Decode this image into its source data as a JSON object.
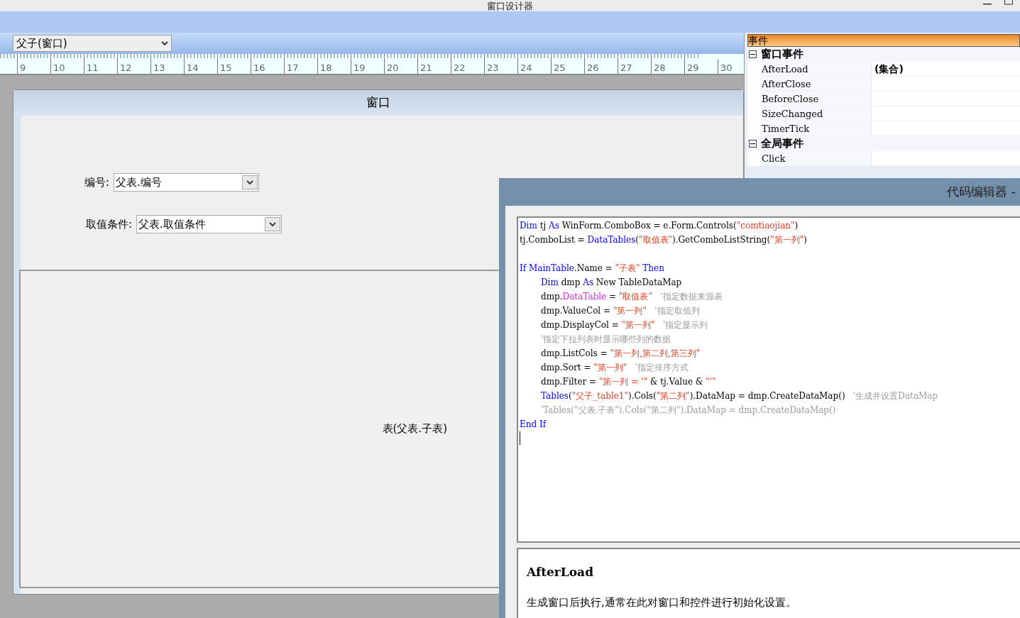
{
  "window": {
    "title": "窗口设计器"
  },
  "toolbar": {
    "form_select": "父子(窗口)"
  },
  "ruler": [
    "9",
    "10",
    "11",
    "12",
    "13",
    "14",
    "15",
    "16",
    "17",
    "18",
    "19",
    "20",
    "21",
    "22",
    "23",
    "24",
    "25",
    "26",
    "27",
    "28",
    "29",
    "30"
  ],
  "form": {
    "title": "窗口",
    "fields": [
      {
        "label": "编号:",
        "value": "父表.编号"
      },
      {
        "label": "取值条件:",
        "value": "父表.取值条件"
      }
    ],
    "table_label": "表(父表.子表)"
  },
  "events_panel": {
    "title": "事件",
    "groups": [
      {
        "name": "窗口事件",
        "expanded": true,
        "items": [
          {
            "name": "AfterLoad",
            "value": "(集合)"
          },
          {
            "name": "AfterClose"
          },
          {
            "name": "BeforeClose"
          },
          {
            "name": "SizeChanged"
          },
          {
            "name": "TimerTick"
          }
        ]
      },
      {
        "name": "全局事件",
        "expanded": true,
        "items": [
          {
            "name": "Click"
          }
        ]
      }
    ]
  },
  "code_editor": {
    "title": "代码编辑器 -",
    "lines": [
      {
        "tokens": [
          {
            "kind": "kw",
            "text": "Dim"
          },
          {
            "kind": "plain",
            "text": " tj "
          },
          {
            "kind": "kw",
            "text": "As"
          },
          {
            "kind": "plain",
            "text": " WinForm.ComboBox = e.Form.Controls("
          },
          {
            "kind": "str",
            "text": "\"comtiaojian\""
          },
          {
            "kind": "plain",
            "text": ")"
          }
        ]
      },
      {
        "tokens": [
          {
            "kind": "plain",
            "text": "tj.ComboList = "
          },
          {
            "kind": "kw",
            "text": "DataTables"
          },
          {
            "kind": "plain",
            "text": "("
          },
          {
            "kind": "str",
            "text": "\"取值表\""
          },
          {
            "kind": "plain",
            "text": ").GetComboListString("
          },
          {
            "kind": "str",
            "text": "\"第一列\""
          },
          {
            "kind": "plain",
            "text": ")"
          }
        ]
      },
      {
        "kind": "blank"
      },
      {
        "tokens": [
          {
            "kind": "kw",
            "text": "If"
          },
          {
            "kind": "kw",
            "text": " MainTable"
          },
          {
            "kind": "plain",
            "text": ".Name = "
          },
          {
            "kind": "str",
            "text": "\"子表\""
          },
          {
            "kind": "kw",
            "text": " Then"
          }
        ],
        "children": [
          {
            "tokens": [
              {
                "kind": "kw",
                "text": "Dim"
              },
              {
                "kind": "plain",
                "text": " dmp "
              },
              {
                "kind": "kw",
                "text": "As"
              },
              {
                "kind": "plain",
                "text": " New TableDataMap"
              }
            ]
          },
          {
            "tokens": [
              {
                "kind": "plain",
                "text": "dmp."
              },
              {
                "kind": "prop",
                "text": "DataTable"
              },
              {
                "kind": "plain",
                "text": " = "
              },
              {
                "kind": "str",
                "text": "\"取值表\""
              },
              {
                "kind": "cm",
                "text": "   '指定数据来源表"
              }
            ]
          },
          {
            "tokens": [
              {
                "kind": "plain",
                "text": "dmp.ValueCol = "
              },
              {
                "kind": "str",
                "text": "\"第一列\""
              },
              {
                "kind": "cm",
                "text": "   '指定取值列"
              }
            ]
          },
          {
            "tokens": [
              {
                "kind": "plain",
                "text": "dmp.DisplayCol = "
              },
              {
                "kind": "str",
                "text": "\"第一列\""
              },
              {
                "kind": "cm",
                "text": "   '指定显示列"
              }
            ]
          },
          {
            "tokens": [
              {
                "kind": "cm",
                "text": "'指定下拉列表时显示哪些列的数据"
              }
            ]
          },
          {
            "tokens": [
              {
                "kind": "plain",
                "text": "dmp.ListCols = "
              },
              {
                "kind": "str",
                "text": "\"第一列,第二列,第三列\""
              }
            ]
          },
          {
            "tokens": [
              {
                "kind": "plain",
                "text": "dmp.Sort = "
              },
              {
                "kind": "str",
                "text": "\"第一列\""
              },
              {
                "kind": "cm",
                "text": "   '指定排序方式"
              }
            ]
          },
          {
            "tokens": [
              {
                "kind": "plain",
                "text": "dmp.Filter = "
              },
              {
                "kind": "str",
                "text": "\"第一列 = '\""
              },
              {
                "kind": "plain",
                "text": " & tj.Value & "
              },
              {
                "kind": "str",
                "text": "\"'\""
              }
            ]
          },
          {
            "tokens": [
              {
                "kind": "kw",
                "text": "Tables"
              },
              {
                "kind": "plain",
                "text": "("
              },
              {
                "kind": "str",
                "text": "\"父子_table1\""
              },
              {
                "kind": "plain",
                "text": ").Cols("
              },
              {
                "kind": "str",
                "text": "\"第二列\""
              },
              {
                "kind": "plain",
                "text": ").DataMap = dmp.CreateDataMap()"
              },
              {
                "kind": "cm",
                "text": "   '生成并设置DataMap"
              }
            ]
          },
          {
            "tokens": [
              {
                "kind": "cm",
                "text": "'Tables(\"父表.子表\").Cols(\"第二列\").DataMap = dmp.CreateDataMap()"
              }
            ]
          }
        ]
      },
      {
        "tokens": [
          {
            "kind": "kw",
            "text": "End If"
          }
        ]
      }
    ],
    "help": {
      "title": "AfterLoad",
      "description": "生成窗口后执行,通常在此对窗口和控件进行初始化设置。"
    }
  }
}
